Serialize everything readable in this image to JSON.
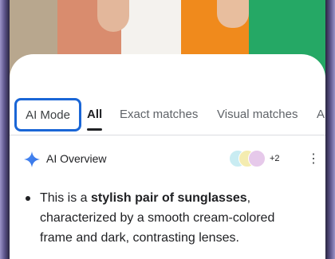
{
  "tabs": {
    "ai_mode": "AI Mode",
    "all": "All",
    "exact": "Exact matches",
    "visual": "Visual matches",
    "more": "A"
  },
  "overview": {
    "label": "AI Overview",
    "source_count": "+2",
    "menu_icon": "⋮"
  },
  "content": {
    "text_1": "This is a ",
    "bold": "stylish pair of sunglasses",
    "text_2": ", characterized by a smooth cream-colored frame and dark, contrasting lenses."
  },
  "colors": {
    "accent": "#1a66d6",
    "text": "#202124",
    "muted": "#5f6368"
  }
}
